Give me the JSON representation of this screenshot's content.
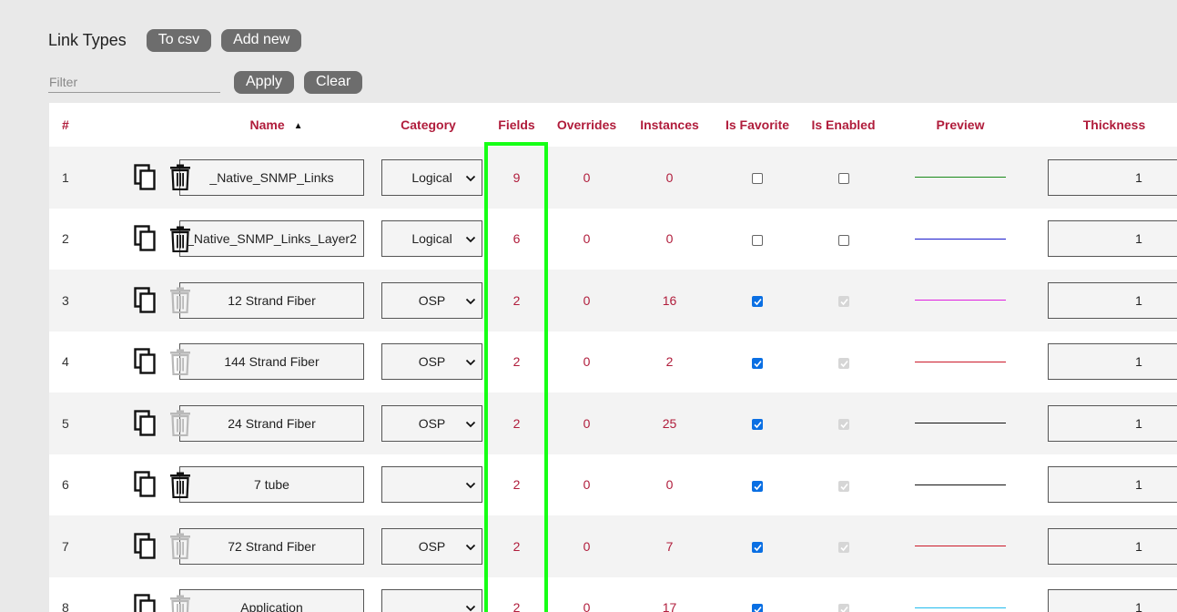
{
  "header": {
    "title": "Link Types",
    "to_csv": "To csv",
    "add_new": "Add new"
  },
  "filter": {
    "placeholder": "Filter",
    "value": "",
    "apply": "Apply",
    "clear": "Clear"
  },
  "columns": {
    "num": "#",
    "name": "Name",
    "category": "Category",
    "fields": "Fields",
    "overrides": "Overrides",
    "instances": "Instances",
    "is_favorite": "Is Favorite",
    "is_enabled": "Is Enabled",
    "preview": "Preview",
    "thickness": "Thickness"
  },
  "rows": [
    {
      "num": "1",
      "name": "_Native_SNMP_Links",
      "category": "Logical",
      "fields": "9",
      "overrides": "0",
      "instances": "0",
      "favorite": false,
      "enabled": false,
      "enabled_disabled": false,
      "delete_enabled": true,
      "preview_color": "#1a8a1a",
      "thickness": "1"
    },
    {
      "num": "2",
      "name": "_Native_SNMP_Links_Layer2",
      "category": "Logical",
      "fields": "6",
      "overrides": "0",
      "instances": "0",
      "favorite": false,
      "enabled": false,
      "enabled_disabled": false,
      "delete_enabled": true,
      "preview_color": "#1a1acc",
      "thickness": "1"
    },
    {
      "num": "3",
      "name": "12 Strand Fiber",
      "category": "OSP",
      "fields": "2",
      "overrides": "0",
      "instances": "16",
      "favorite": true,
      "enabled": true,
      "enabled_disabled": true,
      "delete_enabled": false,
      "preview_color": "#e020e0",
      "thickness": "1"
    },
    {
      "num": "4",
      "name": "144 Strand Fiber",
      "category": "OSP",
      "fields": "2",
      "overrides": "0",
      "instances": "2",
      "favorite": true,
      "enabled": true,
      "enabled_disabled": true,
      "delete_enabled": false,
      "preview_color": "#cc1a2a",
      "thickness": "1"
    },
    {
      "num": "5",
      "name": "24 Strand Fiber",
      "category": "OSP",
      "fields": "2",
      "overrides": "0",
      "instances": "25",
      "favorite": true,
      "enabled": true,
      "enabled_disabled": true,
      "delete_enabled": false,
      "preview_color": "#111111",
      "thickness": "1"
    },
    {
      "num": "6",
      "name": "7 tube",
      "category": "",
      "fields": "2",
      "overrides": "0",
      "instances": "0",
      "favorite": true,
      "enabled": true,
      "enabled_disabled": true,
      "delete_enabled": true,
      "preview_color": "#111111",
      "thickness": "1"
    },
    {
      "num": "7",
      "name": "72 Strand Fiber",
      "category": "OSP",
      "fields": "2",
      "overrides": "0",
      "instances": "7",
      "favorite": true,
      "enabled": true,
      "enabled_disabled": true,
      "delete_enabled": false,
      "preview_color": "#cc1a2a",
      "thickness": "1"
    },
    {
      "num": "8",
      "name": "Application",
      "category": "",
      "fields": "2",
      "overrides": "0",
      "instances": "17",
      "favorite": true,
      "enabled": true,
      "enabled_disabled": true,
      "delete_enabled": false,
      "preview_color": "#22bbee",
      "thickness": "1"
    }
  ],
  "colors": {
    "accent": "#b01c3b",
    "highlight": "#16ff16",
    "button": "#6d6d6d",
    "checked": "#0a6fe3"
  },
  "icons": {
    "copy": "copy-icon",
    "delete": "trash-icon",
    "sort": "sort-ascending-icon",
    "dropdown": "chevron-down-icon"
  }
}
